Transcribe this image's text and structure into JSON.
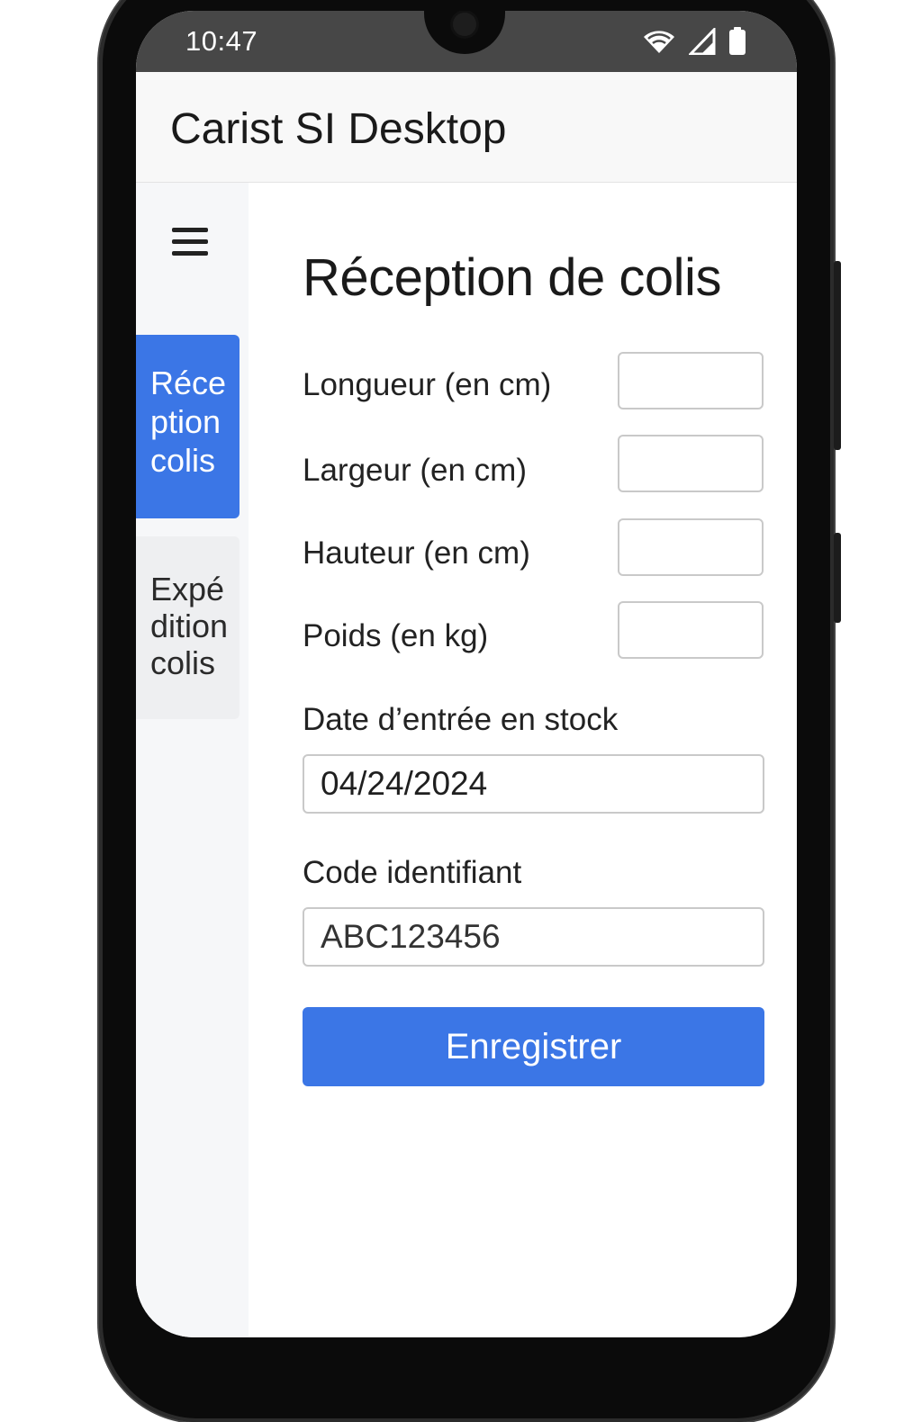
{
  "status_bar": {
    "time": "10:47",
    "icons": [
      "wifi-icon",
      "cellular-signal-icon",
      "battery-icon"
    ]
  },
  "app_header": {
    "title": "Carist SI Desktop"
  },
  "sidebar": {
    "menu_icon": "hamburger-menu-icon",
    "items": [
      {
        "label": "Réception colis",
        "active": true
      },
      {
        "label": "Expédition colis",
        "active": false
      }
    ]
  },
  "main": {
    "title": "Réception de colis",
    "fields": [
      {
        "label": "Longueur (en cm)",
        "value": ""
      },
      {
        "label": "Largeur (en cm)",
        "value": ""
      },
      {
        "label": "Hauteur (en cm)",
        "value": ""
      },
      {
        "label": "Poids (en kg)",
        "value": ""
      }
    ],
    "date": {
      "label": "Date d’entrée en stock",
      "value": "04/24/2024"
    },
    "code": {
      "label": "Code identifiant",
      "value": "ABC123456"
    },
    "save_label": "Enregistrer"
  },
  "colors": {
    "accent": "#3b76e6",
    "status_bar": "#474747",
    "header_bg": "#f8f8f8",
    "sidebar_bg": "#f6f7f9"
  }
}
